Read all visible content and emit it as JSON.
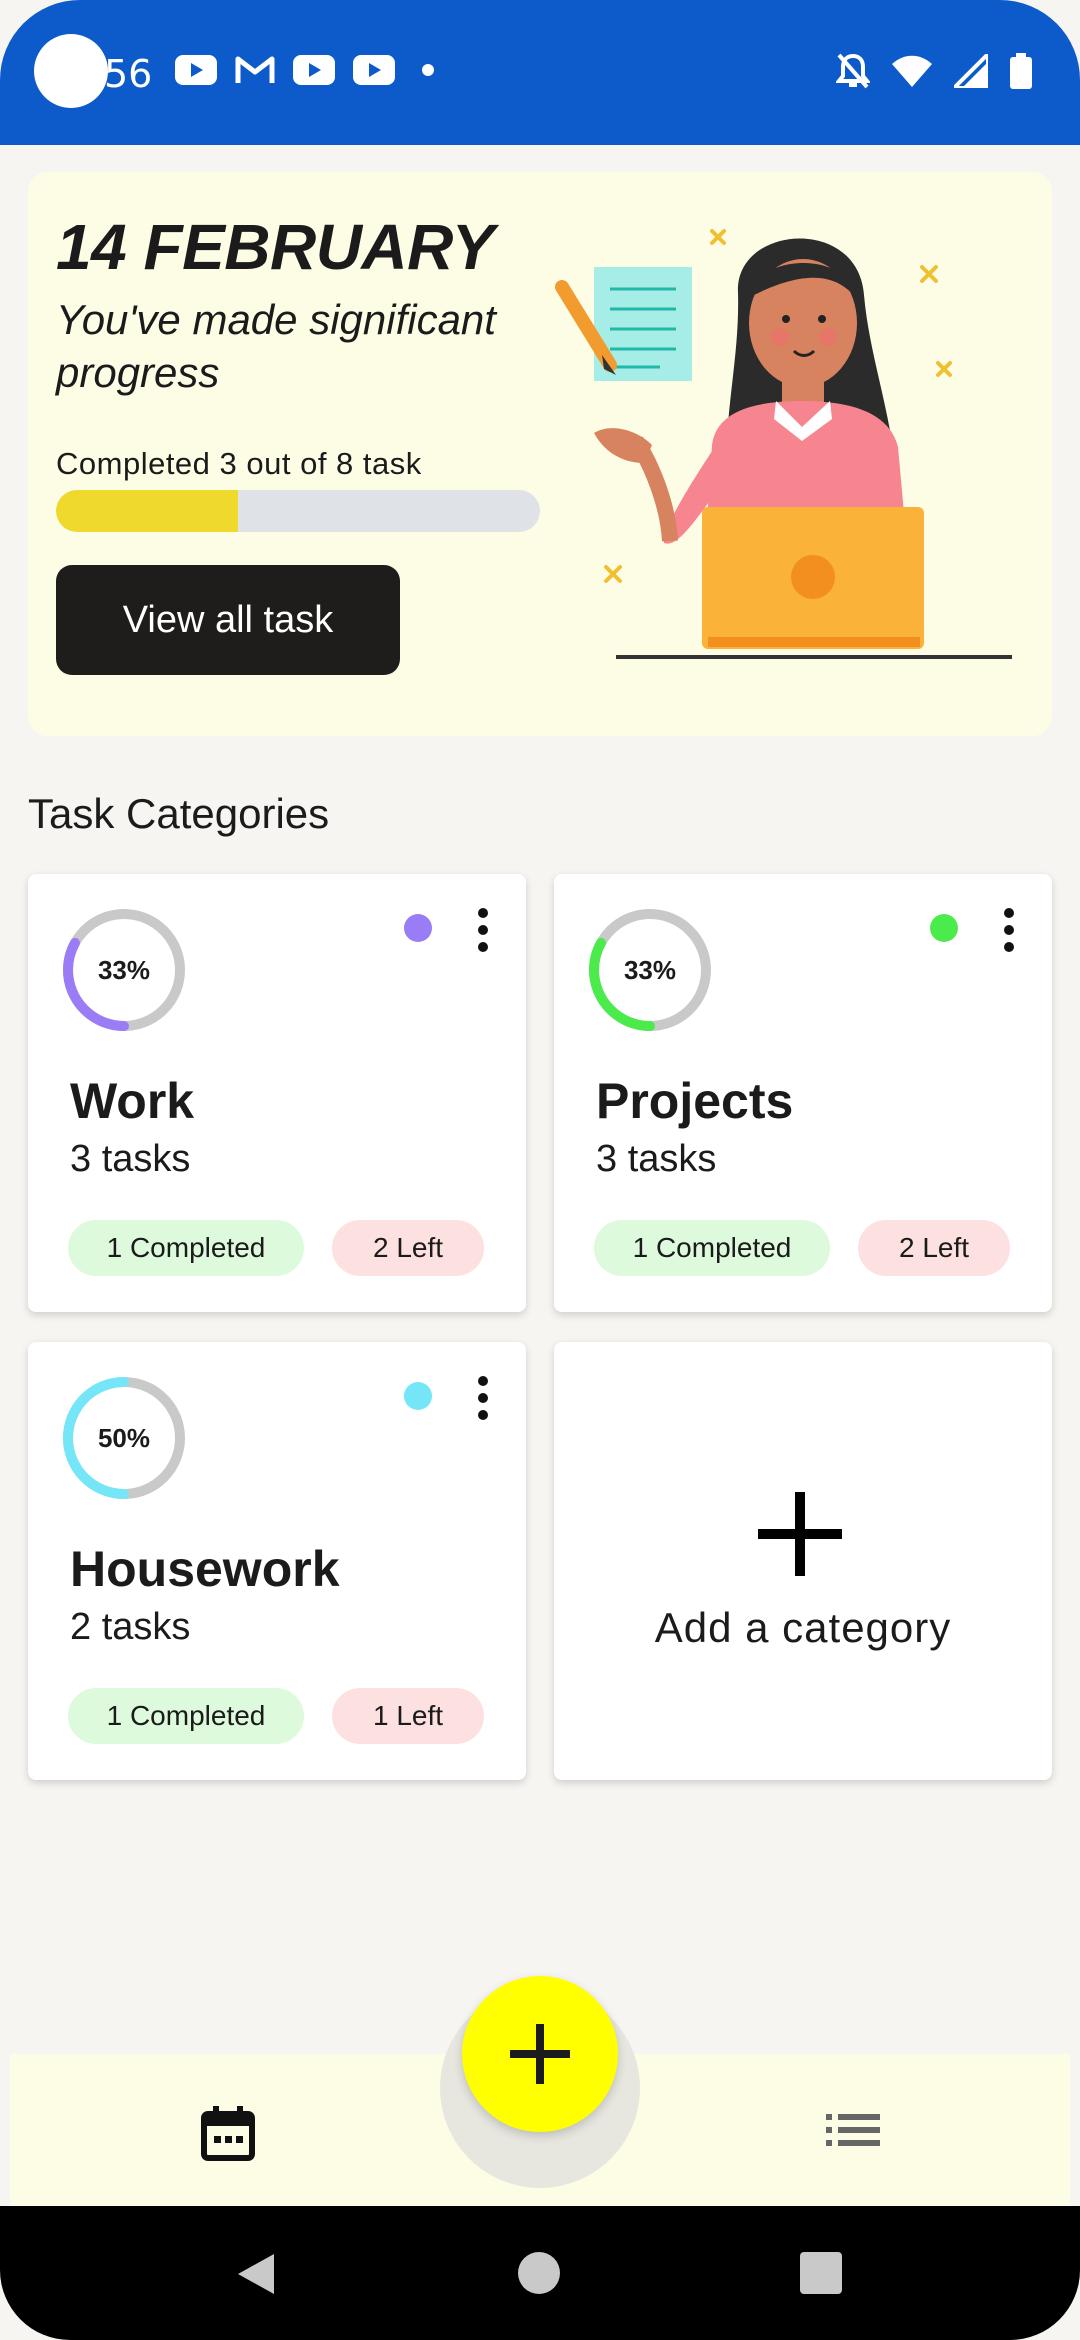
{
  "status_bar": {
    "time": "56",
    "notification_icons": [
      "youtube-icon",
      "gmail-icon",
      "youtube-icon",
      "youtube-icon",
      "more-notifications-dot"
    ],
    "system_icons": [
      "notifications-off-icon",
      "wifi-icon",
      "signal-icon",
      "battery-icon"
    ],
    "color": "#0d5acb"
  },
  "hero": {
    "date": "14 FEBRUARY",
    "message": "You've made significant progress",
    "progress_label": "Completed 3 out of 8 task",
    "completed": 3,
    "total": 8,
    "progress_fraction": 0.375,
    "button_label": "View all task",
    "background": "#fdfde6",
    "progress_color": "#efd92c"
  },
  "section_title": "Task Categories",
  "categories": [
    {
      "name": "Work",
      "count": "3 tasks",
      "percent": "33%",
      "progress": 0.33,
      "color": "#9b7cf7",
      "completed": "1 Completed",
      "left": "2 Left"
    },
    {
      "name": "Projects",
      "count": "3 tasks",
      "percent": "33%",
      "progress": 0.33,
      "color": "#4ceb4c",
      "completed": "1 Completed",
      "left": "2 Left"
    },
    {
      "name": "Housework",
      "count": "2 tasks",
      "percent": "50%",
      "progress": 0.5,
      "color": "#74e6f7",
      "completed": "1 Completed",
      "left": "1 Left"
    }
  ],
  "add_category": {
    "label": "Add a category",
    "icon": "plus-icon"
  },
  "bottom_nav": {
    "items": [
      "calendar-icon",
      "list-icon"
    ],
    "fab_icon": "plus-icon",
    "fab_color": "#ffff00"
  },
  "system_nav": [
    "back-button",
    "home-button",
    "recents-button"
  ]
}
